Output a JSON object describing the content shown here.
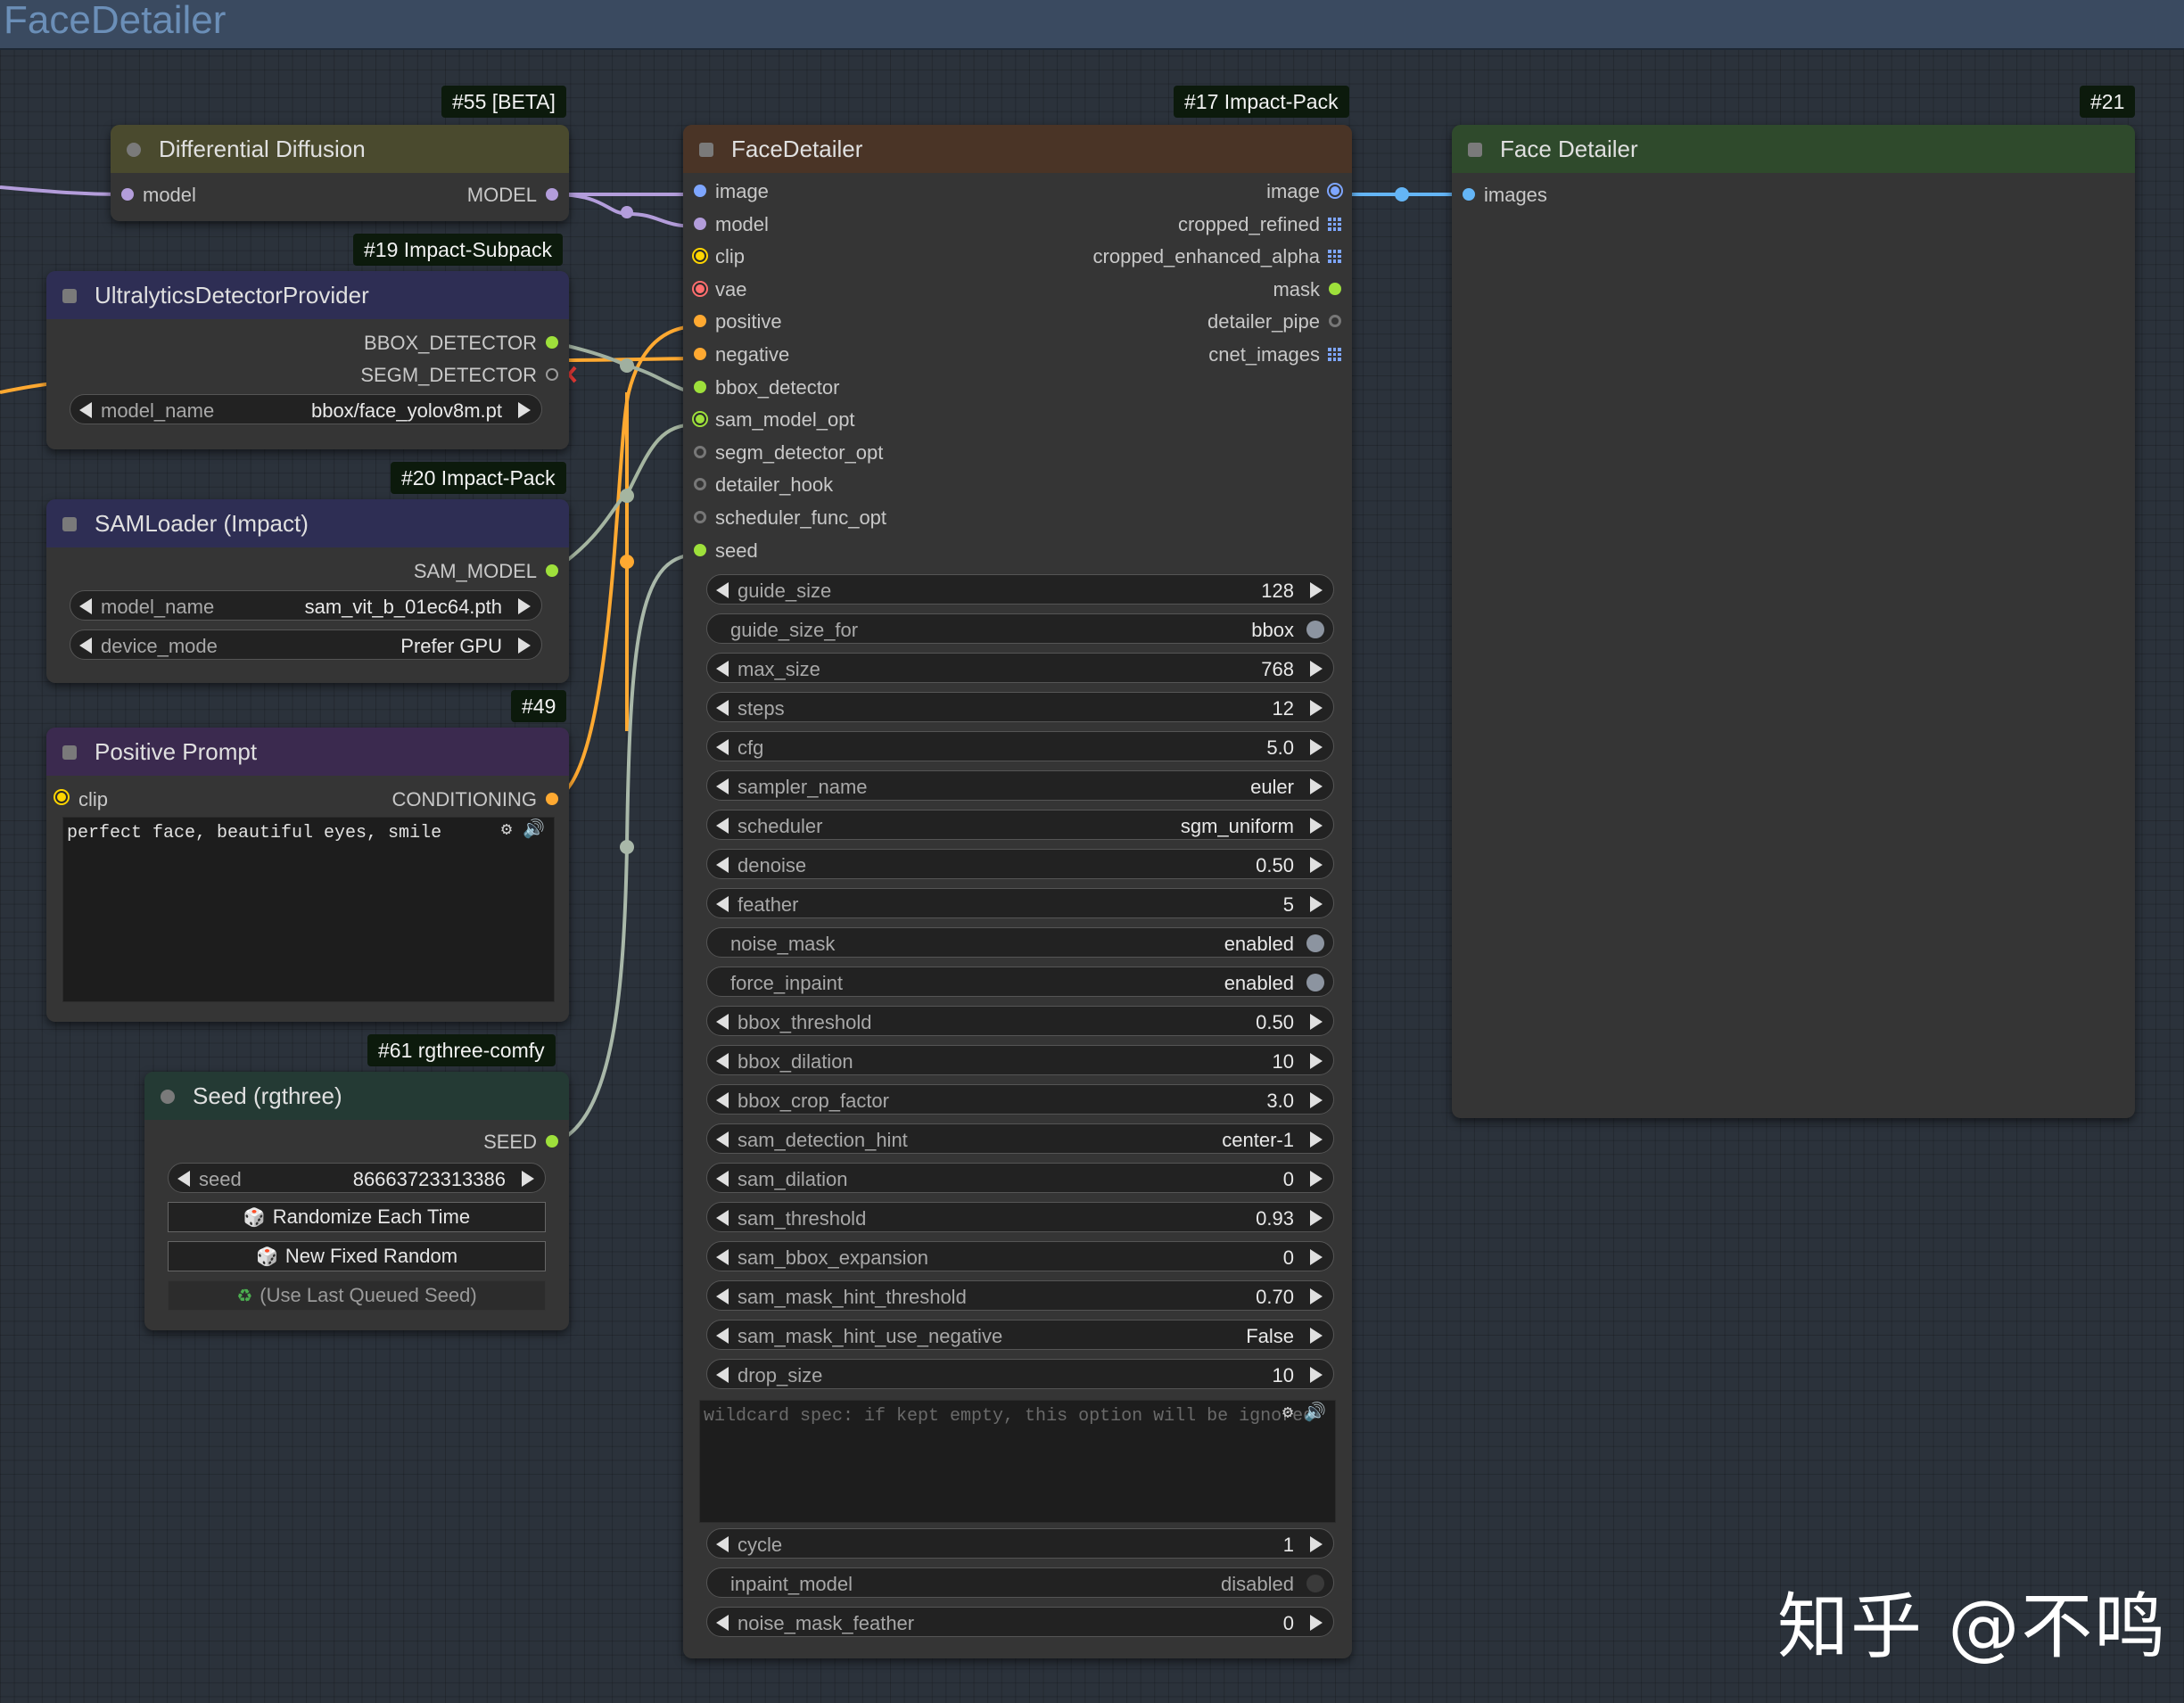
{
  "topbar": {
    "title": "FaceDetailer"
  },
  "colors": {
    "canvas": "#2b323b",
    "link_model": "#b39ddb",
    "link_image": "#64b5f6",
    "link_conditioning": "#ffa931",
    "link_bbox": "#a0b0a0",
    "link_sam": "#a5b5a0",
    "link_seed": "#a9b8a9"
  },
  "nodes": {
    "differential_diffusion": {
      "badge": "#55 [BETA]",
      "title": "Differential Diffusion",
      "input_model": "model",
      "output_model": "MODEL"
    },
    "ultralytics": {
      "badge": "#19 Impact-Subpack",
      "title": "UltralyticsDetectorProvider",
      "output_bbox": "BBOX_DETECTOR",
      "output_segm": "SEGM_DETECTOR",
      "model_name_label": "model_name",
      "model_name_value": "bbox/face_yolov8m.pt"
    },
    "samloader": {
      "badge": "#20 Impact-Pack",
      "title": "SAMLoader (Impact)",
      "output": "SAM_MODEL",
      "model_name_label": "model_name",
      "model_name_value": "sam_vit_b_01ec64.pth",
      "device_mode_label": "device_mode",
      "device_mode_value": "Prefer GPU"
    },
    "positive_prompt": {
      "badge": "#49",
      "title": "Positive Prompt",
      "input_clip": "clip",
      "output": "CONDITIONING",
      "text": "perfect face, beautiful eyes, smile",
      "icons": "⚙ 🔊"
    },
    "seed": {
      "badge": "#61 rgthree-comfy",
      "title": "Seed (rgthree)",
      "output": "SEED",
      "seed_label": "seed",
      "seed_value": "86663723313386",
      "btn_randomize": "Randomize Each Time",
      "btn_new_fixed": "New Fixed Random",
      "btn_last_queued": "(Use Last Queued Seed)"
    },
    "facedetailer": {
      "badge": "#17 Impact-Pack",
      "title": "FaceDetailer",
      "inputs": [
        "image",
        "model",
        "clip",
        "vae",
        "positive",
        "negative",
        "bbox_detector",
        "sam_model_opt",
        "segm_detector_opt",
        "detailer_hook",
        "scheduler_func_opt",
        "seed"
      ],
      "outputs": [
        "image",
        "cropped_refined",
        "cropped_enhanced_alpha",
        "mask",
        "detailer_pipe",
        "cnet_images"
      ],
      "widgets": [
        {
          "label": "guide_size",
          "value": "128",
          "kind": "num"
        },
        {
          "label": "guide_size_for",
          "value": "bbox",
          "kind": "toggle"
        },
        {
          "label": "max_size",
          "value": "768",
          "kind": "num"
        },
        {
          "label": "steps",
          "value": "12",
          "kind": "num"
        },
        {
          "label": "cfg",
          "value": "5.0",
          "kind": "num"
        },
        {
          "label": "sampler_name",
          "value": "euler",
          "kind": "num"
        },
        {
          "label": "scheduler",
          "value": "sgm_uniform",
          "kind": "num"
        },
        {
          "label": "denoise",
          "value": "0.50",
          "kind": "num"
        },
        {
          "label": "feather",
          "value": "5",
          "kind": "num"
        },
        {
          "label": "noise_mask",
          "value": "enabled",
          "kind": "toggle"
        },
        {
          "label": "force_inpaint",
          "value": "enabled",
          "kind": "toggle"
        },
        {
          "label": "bbox_threshold",
          "value": "0.50",
          "kind": "num"
        },
        {
          "label": "bbox_dilation",
          "value": "10",
          "kind": "num"
        },
        {
          "label": "bbox_crop_factor",
          "value": "3.0",
          "kind": "num"
        },
        {
          "label": "sam_detection_hint",
          "value": "center-1",
          "kind": "num"
        },
        {
          "label": "sam_dilation",
          "value": "0",
          "kind": "num"
        },
        {
          "label": "sam_threshold",
          "value": "0.93",
          "kind": "num"
        },
        {
          "label": "sam_bbox_expansion",
          "value": "0",
          "kind": "num"
        },
        {
          "label": "sam_mask_hint_threshold",
          "value": "0.70",
          "kind": "num"
        },
        {
          "label": "sam_mask_hint_use_negative",
          "value": "False",
          "kind": "num"
        },
        {
          "label": "drop_size",
          "value": "10",
          "kind": "num"
        }
      ],
      "wildcard_placeholder": "wildcard spec: if kept empty, this option will be ignored",
      "wildcard_icons": "⚙ 🔊",
      "widgets_after": [
        {
          "label": "cycle",
          "value": "1",
          "kind": "num"
        },
        {
          "label": "inpaint_model",
          "value": "disabled",
          "kind": "toggle_off"
        },
        {
          "label": "noise_mask_feather",
          "value": "0",
          "kind": "num"
        }
      ]
    },
    "face_detailer_preview": {
      "badge": "#21",
      "title": "Face Detailer",
      "input_images": "images"
    }
  },
  "watermark": "知乎 @不鸣"
}
